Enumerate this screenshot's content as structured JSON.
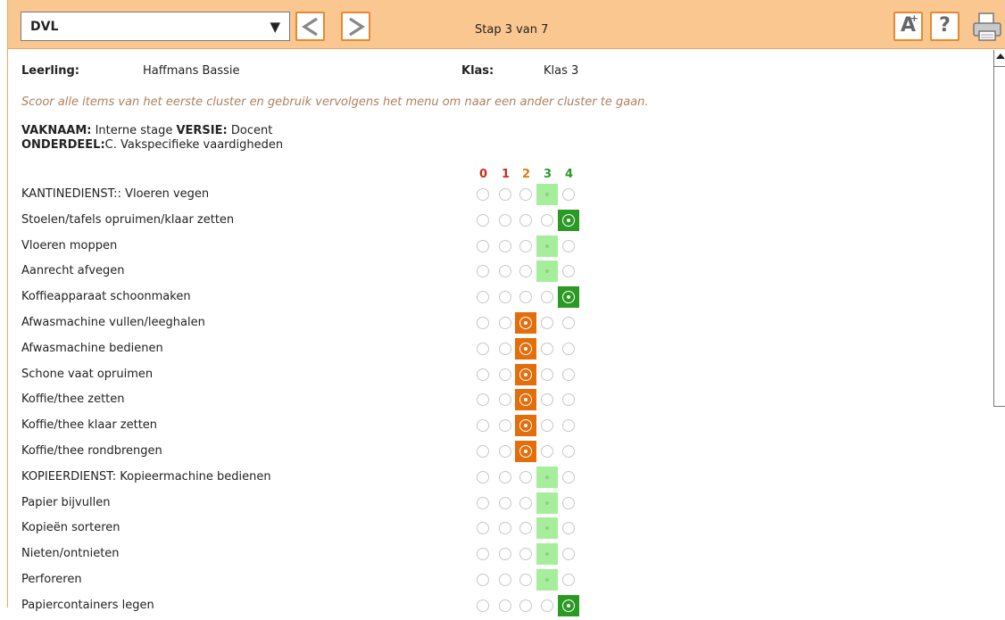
{
  "toolbar": {
    "dropdown_value": "DVL",
    "prev_icon": "chevron-left-icon",
    "next_icon": "chevron-right-icon",
    "step_text": "Stap 3 van 7",
    "font_size_glyph": "A",
    "help_glyph": "?",
    "print_icon": "printer-icon"
  },
  "student": {
    "leerling_label": "Leerling:",
    "leerling_value": "Haffmans Bassie",
    "klas_label": "Klas:",
    "klas_value": "Klas 3"
  },
  "instruction": "Scoor alle items van het eerste cluster en gebruik vervolgens het menu om naar een ander cluster te gaan.",
  "meta": {
    "vaknaam_label": "VAKNAAM:",
    "vaknaam_value": "Interne stage",
    "versie_label": "VERSIE:",
    "versie_value": "Docent",
    "onderdeel_label": "ONDERDEEL:",
    "onderdeel_value": "C. Vakspecifieke vaardigheden"
  },
  "score_headers": [
    "0",
    "1",
    "2",
    "3",
    "4"
  ],
  "colors": {
    "header_bg": "#fbc790",
    "accent_border": "#e58a33",
    "score_0": "#d02a1a",
    "score_1": "#d02a1a",
    "score_2": "#e07b12",
    "score_3": "#2a9a2a",
    "score_4": "#2a9a2a",
    "selected_orange": "#e26f0c",
    "selected_lightgreen": "#a6ee9c",
    "selected_darkgreen": "#2b9a24"
  },
  "items": [
    {
      "name": "KANTINEDIENST:: Vloeren vegen",
      "score": 3
    },
    {
      "name": "Stoelen/tafels opruimen/klaar zetten",
      "score": 4
    },
    {
      "name": "Vloeren moppen",
      "score": 3
    },
    {
      "name": "Aanrecht afvegen",
      "score": 3
    },
    {
      "name": "Koffieapparaat schoonmaken",
      "score": 4
    },
    {
      "name": "Afwasmachine vullen/leeghalen",
      "score": 2
    },
    {
      "name": "Afwasmachine bedienen",
      "score": 2
    },
    {
      "name": "Schone vaat opruimen",
      "score": 2
    },
    {
      "name": "Koffie/thee zetten",
      "score": 2
    },
    {
      "name": "Koffie/thee klaar zetten",
      "score": 2
    },
    {
      "name": "Koffie/thee rondbrengen",
      "score": 2
    },
    {
      "name": "KOPIEERDIENST: Kopieermachine bedienen",
      "score": 3
    },
    {
      "name": "Papier bijvullen",
      "score": 3
    },
    {
      "name": "Kopieën sorteren",
      "score": 3
    },
    {
      "name": "Nieten/ontnieten",
      "score": 3
    },
    {
      "name": "Perforeren",
      "score": 3
    },
    {
      "name": "Papiercontainers legen",
      "score": 4
    }
  ]
}
